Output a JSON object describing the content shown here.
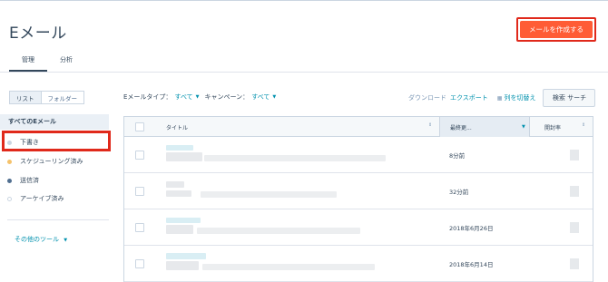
{
  "page": {
    "title": "Eメール",
    "create_button": "メールを作成する"
  },
  "tabs": [
    {
      "label": "管理",
      "active": true
    },
    {
      "label": "分析",
      "active": false
    }
  ],
  "view_toggle": [
    {
      "label": "リスト",
      "active": true
    },
    {
      "label": "フォルダー",
      "active": false
    }
  ],
  "filters": {
    "type_label": "Eメールタイプ：",
    "type_value": "すべて",
    "campaign_label": "キャンペーン：",
    "campaign_value": "すべて"
  },
  "actions": {
    "download": "ダウンロード",
    "export": "エクスポート",
    "columns": "列を切替え",
    "search": "検索 サーチ"
  },
  "sidebar": {
    "heading": "すべてのEメール",
    "items": [
      {
        "label": "下書き",
        "dot_color": "#cbd6e2"
      },
      {
        "label": "スケジューリング済み",
        "dot_color": "#f5c26b"
      },
      {
        "label": "送信済",
        "dot_color": "#516f90"
      },
      {
        "label": "アーケイブ済み",
        "dot_color": "#ffffff"
      }
    ],
    "tools": "その他のツール"
  },
  "table": {
    "columns": {
      "title": "タイトル",
      "updated": "最終更...",
      "open_rate": "開封率"
    },
    "rows": [
      {
        "updated": "8分前"
      },
      {
        "updated": "32分前"
      },
      {
        "updated": "2018年6月26日"
      },
      {
        "updated": "2018年6月14日"
      }
    ]
  },
  "colors": {
    "accent": "#ff5c35",
    "highlight_border": "#e0291b",
    "link": "#0091ae"
  }
}
